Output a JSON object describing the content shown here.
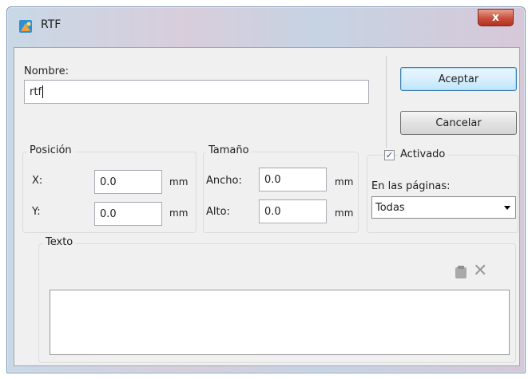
{
  "window": {
    "title": "RTF",
    "close_label": "x"
  },
  "nombre": {
    "label": "Nombre:",
    "value": "rtf"
  },
  "buttons": {
    "accept": "Aceptar",
    "cancel": "Cancelar"
  },
  "posicion": {
    "title": "Posición",
    "x_label": "X:",
    "x_value": "0.0",
    "y_label": "Y:",
    "y_value": "0.0",
    "unit": "mm"
  },
  "tamano": {
    "title": "Tamaño",
    "width_label": "Ancho:",
    "width_value": "0.0",
    "height_label": "Alto:",
    "height_value": "0.0",
    "unit": "mm"
  },
  "activado": {
    "label": "Activado",
    "checked": true,
    "check_glyph": "✓"
  },
  "paginas": {
    "label": "En las páginas:",
    "selected": "Todas"
  },
  "texto": {
    "title": "Texto",
    "value": ""
  },
  "icons": {
    "paste": "paste-icon",
    "clear": "clear-icon",
    "clear_glyph": "✕"
  },
  "colors": {
    "title_close": "#c8503c",
    "default_button": "#3c7fb1",
    "client_bg": "#f0f0f0"
  }
}
